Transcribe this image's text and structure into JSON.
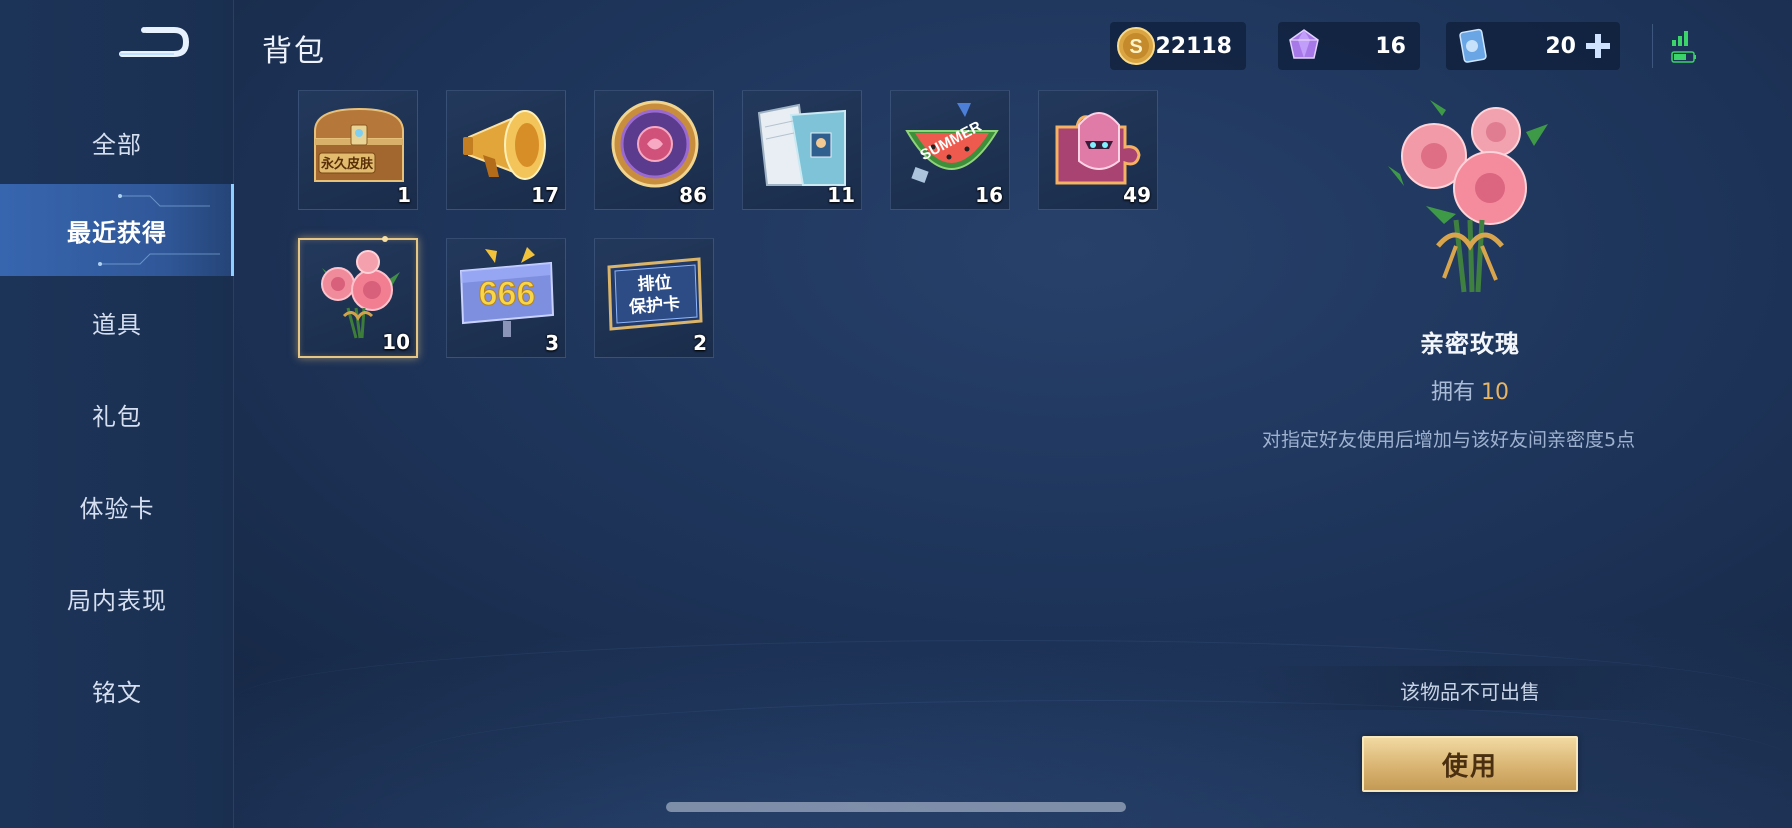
{
  "header": {
    "title": "背包"
  },
  "currencies": {
    "coins": "22118",
    "gems": "16",
    "vouchers": "20"
  },
  "sidebar": {
    "items": [
      {
        "label": "全部"
      },
      {
        "label": "最近获得"
      },
      {
        "label": "道具"
      },
      {
        "label": "礼包"
      },
      {
        "label": "体验卡"
      },
      {
        "label": "局内表现"
      },
      {
        "label": "铭文"
      }
    ],
    "active_index": 1
  },
  "inventory": {
    "items": [
      {
        "icon": "treasure-chest-icon",
        "badge": "永久皮肤",
        "count": "1"
      },
      {
        "icon": "megaphone-icon",
        "count": "17"
      },
      {
        "icon": "rose-medal-icon",
        "count": "86"
      },
      {
        "icon": "book-icon",
        "count": "11"
      },
      {
        "icon": "watermelon-summer-icon",
        "badge": "SUMMER",
        "count": "16"
      },
      {
        "icon": "helmet-puzzle-icon",
        "count": "49"
      },
      {
        "icon": "rose-bouquet-icon",
        "count": "10",
        "selected": true
      },
      {
        "icon": "sign-666-icon",
        "badge": "666",
        "count": "3"
      },
      {
        "icon": "rank-protection-card-icon",
        "badge": "排位\n保护卡",
        "count": "2"
      }
    ]
  },
  "detail": {
    "name": "亲密玫瑰",
    "own_label": "拥有",
    "own_count": "10",
    "description": "对指定好友使用后增加与该好友间亲密度5点",
    "unsellable": "该物品不可出售",
    "use_label": "使用"
  },
  "colors": {
    "accent_gold": "#e6c684",
    "own_count": "#e7b564",
    "active_nav": "#3c6ebe"
  }
}
